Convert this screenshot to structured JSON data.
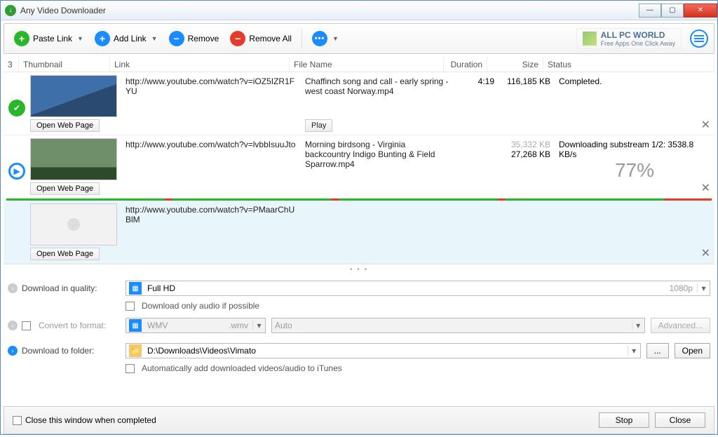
{
  "window": {
    "title": "Any Video Downloader"
  },
  "toolbar": {
    "paste": "Paste Link",
    "add": "Add Link",
    "remove": "Remove",
    "removeAll": "Remove All",
    "logo_top": "ALL PC WORLD",
    "logo_sub": "Free Apps One Click Away"
  },
  "headers": {
    "count": "3",
    "thumbnail": "Thumbnail",
    "link": "Link",
    "filename": "File Name",
    "duration": "Duration",
    "size": "Size",
    "status": "Status"
  },
  "rows": [
    {
      "link": "http://www.youtube.com/watch?v=iOZ5IZR1FYU",
      "file": "Chaffinch song and call - early spring - west coast Norway.mp4",
      "duration": "4:19",
      "size": "116,185 KB",
      "status": "Completed.",
      "open": "Open Web Page",
      "play": "Play"
    },
    {
      "link": "http://www.youtube.com/watch?v=lvbbIsuuJto",
      "file": "Morning birdsong - Virginia backcountry Indigo Bunting & Field Sparrow.mp4",
      "duration": "",
      "size_total": "35,332 KB",
      "size_done": "27,268 KB",
      "status": "Downloading substream 1/2: 3538.8 KB/s",
      "percent": "77%",
      "open": "Open Web Page"
    },
    {
      "link": "http://www.youtube.com/watch?v=PMaarChUBlM",
      "open": "Open Web Page"
    }
  ],
  "options": {
    "quality_label": "Download in quality:",
    "quality_value": "Full HD",
    "quality_suffix": "1080p",
    "audio_only": "Download only audio if possible",
    "convert_label": "Convert to format:",
    "convert_value": "WMV",
    "convert_ext": ".wmv",
    "convert_preset": "Auto",
    "advanced": "Advanced...",
    "folder_label": "Download to folder:",
    "folder_value": "D:\\Downloads\\Videos\\Vimato",
    "browse": "...",
    "open": "Open",
    "itunes": "Automatically add downloaded videos/audio to iTunes"
  },
  "footer": {
    "close_when_done": "Close this window when completed",
    "stop": "Stop",
    "close": "Close"
  }
}
